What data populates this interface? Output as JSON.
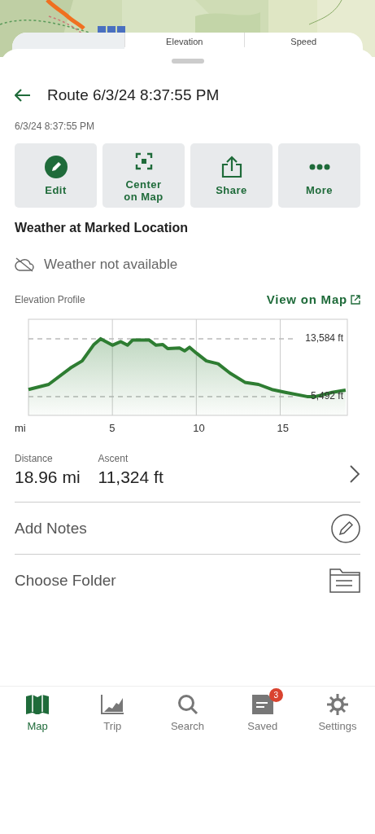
{
  "behind_tabs": [
    {
      "label": "Elevation"
    },
    {
      "label": "Speed"
    }
  ],
  "header": {
    "title": "Route 6/3/24 8:37:55 PM",
    "subtitle": "6/3/24 8:37:55 PM"
  },
  "actions": [
    {
      "kind": "edit",
      "label": "Edit"
    },
    {
      "kind": "center",
      "label": "Center\non Map"
    },
    {
      "kind": "share",
      "label": "Share"
    },
    {
      "kind": "more",
      "label": "More"
    }
  ],
  "weather": {
    "title": "Weather at Marked Location",
    "status": "Weather not available"
  },
  "elevation": {
    "title": "Elevation Profile",
    "link": "View on Map",
    "chart_data": {
      "type": "area",
      "xlabel": "mi",
      "xlim": [
        0,
        19
      ],
      "ylim": [
        2870,
        16320
      ],
      "xticks": [
        5,
        10,
        15
      ],
      "grid": true,
      "yticks": [
        {
          "value": 5492,
          "label": "5,492 ft"
        },
        {
          "value": 13584,
          "label": "13,584 ft"
        }
      ],
      "x": [
        0,
        1.2,
        2.5,
        3.2,
        3.9,
        4.3,
        5.0,
        5.5,
        5.9,
        6.2,
        7.2,
        7.6,
        8.0,
        8.3,
        9.0,
        9.3,
        9.6,
        10.0,
        10.6,
        11.3,
        12.0,
        12.9,
        13.7,
        14.5,
        15.3,
        16.6,
        17.1,
        18.1,
        18.9
      ],
      "series": [
        {
          "color": "#2e7d32",
          "values": [
            6500,
            7200,
            9500,
            10500,
            12800,
            13600,
            12700,
            13200,
            12700,
            13400,
            13400,
            12700,
            12800,
            12200,
            12300,
            11900,
            12400,
            11600,
            10500,
            10100,
            8800,
            7500,
            7200,
            6500,
            6100,
            5500,
            5500,
            6100,
            6400
          ]
        }
      ]
    }
  },
  "stats": [
    {
      "label": "Distance",
      "value": "18.96 mi"
    },
    {
      "label": "Ascent",
      "value": "11,324 ft"
    }
  ],
  "rows": [
    {
      "kind": "notes",
      "label": "Add Notes"
    },
    {
      "kind": "folder",
      "label": "Choose Folder"
    }
  ],
  "nav": [
    {
      "kind": "map",
      "label": "Map",
      "selected": true
    },
    {
      "kind": "trip",
      "label": "Trip",
      "selected": false
    },
    {
      "kind": "search",
      "label": "Search",
      "selected": false
    },
    {
      "kind": "saved",
      "label": "Saved",
      "selected": false,
      "badge": "3"
    },
    {
      "kind": "settings",
      "label": "Settings",
      "selected": false
    }
  ]
}
